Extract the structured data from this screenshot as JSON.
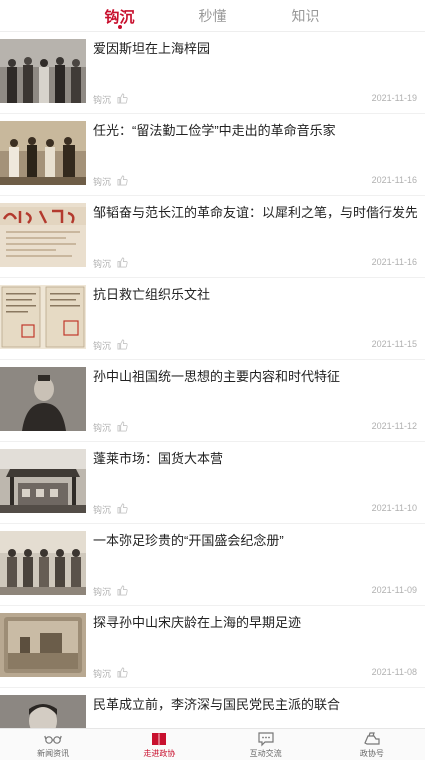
{
  "tabs": [
    {
      "label": "钩沉",
      "active": true
    },
    {
      "label": "秒懂",
      "active": false
    },
    {
      "label": "知识",
      "active": false
    }
  ],
  "articles": [
    {
      "title": "爱因斯坦在上海梓园",
      "source": "钩沉",
      "date": "2021-11-19"
    },
    {
      "title": "任光：“留法勤工俭学”中走出的革命音乐家",
      "source": "钩沉",
      "date": "2021-11-16"
    },
    {
      "title": "邹韬奋与范长江的革命友谊：以犀利之笔，与时偕行发先声",
      "source": "钩沉",
      "date": "2021-11-16"
    },
    {
      "title": "抗日救亡组织乐文社",
      "source": "钩沉",
      "date": "2021-11-15"
    },
    {
      "title": "孙中山祖国统一思想的主要内容和时代特征",
      "source": "钩沉",
      "date": "2021-11-12"
    },
    {
      "title": "蓬莱市场：国货大本营",
      "source": "钩沉",
      "date": "2021-11-10"
    },
    {
      "title": "一本弥足珍贵的“开国盛会纪念册”",
      "source": "钩沉",
      "date": "2021-11-09"
    },
    {
      "title": "探寻孙中山宋庆龄在上海的早期足迹",
      "source": "钩沉",
      "date": "2021-11-08"
    },
    {
      "title": "民革成立前，李济深与国民党民主派的联合",
      "source": "",
      "date": ""
    }
  ],
  "bottom_nav": [
    {
      "label": "新闻资讯",
      "icon": "glasses-icon",
      "active": false
    },
    {
      "label": "走进政协",
      "icon": "book-icon",
      "active": true
    },
    {
      "label": "互动交流",
      "icon": "chat-icon",
      "active": false
    },
    {
      "label": "政协号",
      "icon": "hand-icon",
      "active": false
    }
  ],
  "colors": {
    "accent": "#c8102e",
    "muted": "#b0b0b0"
  }
}
